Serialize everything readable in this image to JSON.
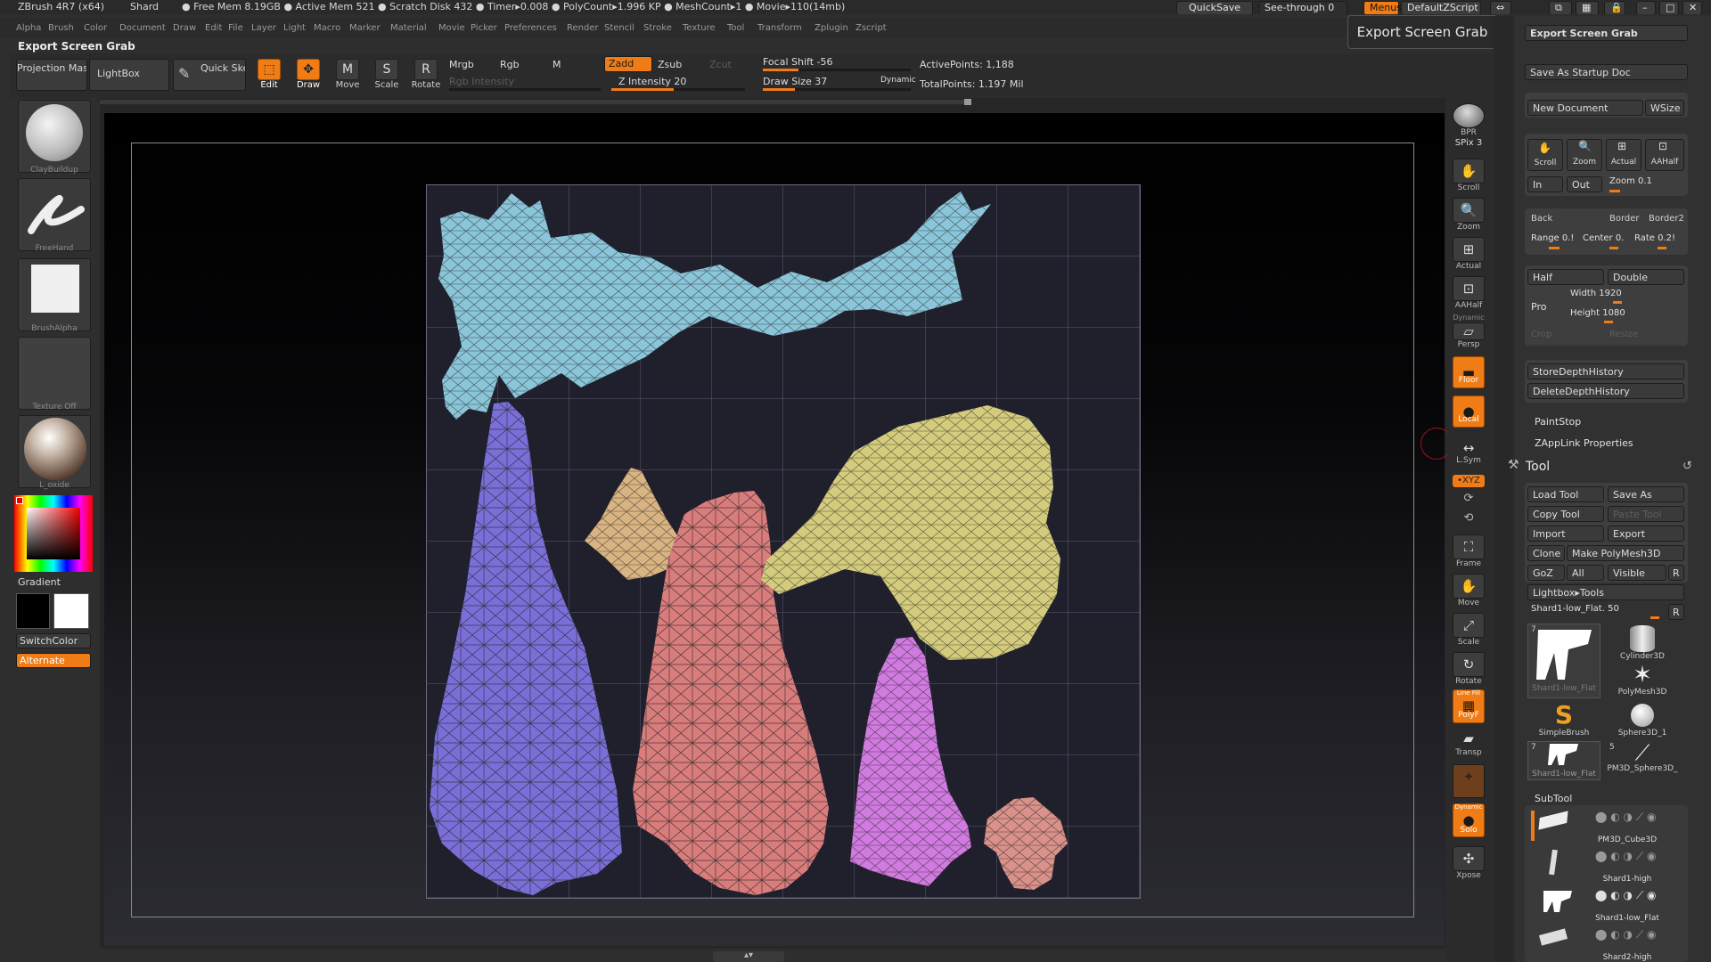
{
  "titlebar": {
    "app": "ZBrush 4R7 (x64)",
    "doc": "Shard",
    "stats": "● Free Mem 8.19GB ● Active Mem 521 ● Scratch Disk 432 ● Timer▸0.008 ● PolyCount▸1.996 KP ● MeshCount▸1  ● Movie▸110(14mb)",
    "quicksave": "QuickSave",
    "seethrough": "See-through  0",
    "menus": "Menus",
    "script": "DefaultZScript"
  },
  "menubar": [
    "Alpha",
    "Brush",
    "Color",
    "Document",
    "Draw",
    "Edit",
    "File",
    "Layer",
    "Light",
    "Macro",
    "Marker",
    "Material",
    "Movie",
    "Picker",
    "Preferences",
    "Render",
    "Stencil",
    "Stroke",
    "Texture",
    "Tool",
    "Transform",
    "Zplugin",
    "Zscript"
  ],
  "palette_title": "Export Screen Grab",
  "tooltip": "Export Screen Grab",
  "shelf": {
    "projection_master": "Projection Master",
    "lightbox": "LightBox",
    "quick_sketch": "Quick Sketch",
    "edit": "Edit",
    "draw": "Draw",
    "move": "Move",
    "scale": "Scale",
    "rotate": "Rotate",
    "mrgb": "Mrgb",
    "rgb": "Rgb",
    "m": "M",
    "rgb_intensity": "Rgb Intensity",
    "zadd": "Zadd",
    "zsub": "Zsub",
    "zcut": "Zcut",
    "z_intensity": "Z Intensity 20",
    "focal_shift": "Focal Shift -56",
    "draw_size": "Draw Size 37",
    "dynamic": "Dynamic",
    "active_points": "ActivePoints: 1,188",
    "total_points": "TotalPoints: 1.197 Mil"
  },
  "left": {
    "brush": "ClayBuildup",
    "stroke": "FreeHand",
    "alpha": "BrushAlpha",
    "texture": "Texture Off",
    "material": "L_oxide",
    "gradient": "Gradient",
    "switchcolor": "SwitchColor",
    "alternate": "Alternate"
  },
  "rightshelf": {
    "bpr": "BPR",
    "spix": "SPix 3",
    "scroll": "Scroll",
    "zoom": "Zoom",
    "actual": "Actual",
    "aahalf": "AAHalf",
    "dynamic": "Dynamic",
    "persp": "Persp",
    "floor": "Floor",
    "local": "Local",
    "lsym": "L.Sym",
    "xyz": "•XYZ",
    "frame": "Frame",
    "move": "Move",
    "scale": "Scale",
    "rotate": "Rotate",
    "linefill": "Line Fill",
    "polyf": "PolyF",
    "transp": "Transp",
    "ghost": "Ghost",
    "dynamic2": "Dynamic",
    "solo": "Solo",
    "xpose": "Xpose"
  },
  "document": {
    "export": "Export Screen Grab",
    "save_startup": "Save As Startup Doc",
    "new_document": "New Document",
    "wsize": "WSize",
    "scroll": "Scroll",
    "zoom": "Zoom",
    "actual": "Actual",
    "aahalf": "AAHalf",
    "in": "In",
    "out": "Out",
    "zoom_val": "Zoom 0.1",
    "back": "Back",
    "border": "Border",
    "border2": "Border2",
    "range": "Range 0.!",
    "center": "Center 0.",
    "rate": "Rate 0.2!",
    "half": "Half",
    "double": "Double",
    "pro": "Pro",
    "width": "Width 1920",
    "height": "Height 1080",
    "crop": "Crop",
    "resize": "Resize",
    "store_depth": "StoreDepthHistory",
    "delete_depth": "DeleteDepthHistory",
    "paintstop": "PaintStop",
    "zapplink": "ZAppLink Properties"
  },
  "tool": {
    "title": "Tool",
    "load": "Load Tool",
    "save_as": "Save As",
    "copy": "Copy Tool",
    "paste": "Paste Tool",
    "import": "Import",
    "export": "Export",
    "clone": "Clone",
    "make_polymesh": "Make PolyMesh3D",
    "goz": "GoZ",
    "all": "All",
    "visible": "Visible",
    "r": "R",
    "lightbox_tools": "Lightbox▸Tools",
    "current": "Shard1-low_Flat. 50",
    "thumbs": [
      "Shard1-low_Flat",
      "Cylinder3D",
      "PolyMesh3D",
      "SimpleBrush",
      "Sphere3D_1",
      "Shard1-low_Flat",
      "PM3D_Sphere3D_"
    ],
    "thumb_counts": [
      "7",
      "",
      "",
      "",
      "",
      "7",
      "5"
    ],
    "subtool_title": "SubTool",
    "subtools": [
      "PM3D_Cube3D",
      "Shard1-high",
      "Shard1-low_Flat",
      "Shard2-high"
    ]
  },
  "colors": {
    "accent": "#f07c16",
    "uv_blue": "#8ac5d9",
    "uv_purple": "#7a6fd8",
    "uv_tan": "#d9b482",
    "uv_red": "#d97c7c",
    "uv_yellow": "#d4cc7c",
    "uv_magenta": "#d17ae0",
    "uv_salmon": "#d9918a"
  }
}
